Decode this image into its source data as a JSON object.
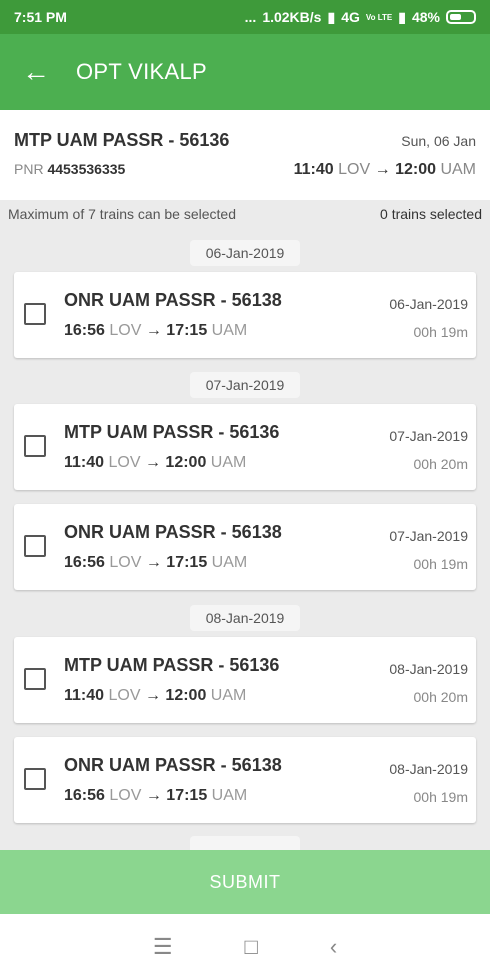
{
  "status_bar": {
    "time": "7:51 PM",
    "dots": "...",
    "speed": "1.02KB/s",
    "net": "4G",
    "volte": "Vo LTE",
    "battery": "48%"
  },
  "app_bar": {
    "title": "OPT VIKALP",
    "back_icon": "arrow-left"
  },
  "summary": {
    "train": "MTP UAM PASSR - 56136",
    "date": "Sun, 06 Jan",
    "pnr_label": "PNR",
    "pnr": "4453536335",
    "dep_time": "11:40",
    "from": "LOV",
    "arr_time": "12:00",
    "to": "UAM"
  },
  "info": {
    "max_text": "Maximum of 7 trains can be selected",
    "selected_text": "0 trains selected"
  },
  "arrow": "→",
  "groups": [
    {
      "date": "06-Jan-2019",
      "trains": [
        {
          "name": "ONR UAM PASSR - 56138",
          "dep": "16:56",
          "from": "LOV",
          "arr": "17:15",
          "to": "UAM",
          "date": "06-Jan-2019",
          "duration": "00h 19m"
        }
      ]
    },
    {
      "date": "07-Jan-2019",
      "trains": [
        {
          "name": "MTP UAM PASSR - 56136",
          "dep": "11:40",
          "from": "LOV",
          "arr": "12:00",
          "to": "UAM",
          "date": "07-Jan-2019",
          "duration": "00h 20m"
        },
        {
          "name": "ONR UAM PASSR - 56138",
          "dep": "16:56",
          "from": "LOV",
          "arr": "17:15",
          "to": "UAM",
          "date": "07-Jan-2019",
          "duration": "00h 19m"
        }
      ]
    },
    {
      "date": "08-Jan-2019",
      "trains": [
        {
          "name": "MTP UAM PASSR - 56136",
          "dep": "11:40",
          "from": "LOV",
          "arr": "12:00",
          "to": "UAM",
          "date": "08-Jan-2019",
          "duration": "00h 20m"
        },
        {
          "name": "ONR UAM PASSR - 56138",
          "dep": "16:56",
          "from": "LOV",
          "arr": "17:15",
          "to": "UAM",
          "date": "08-Jan-2019",
          "duration": "00h 19m"
        }
      ]
    }
  ],
  "submit_label": "SUBMIT",
  "nav": {
    "menu": "☰",
    "home": "□",
    "back": "‹"
  },
  "colors": {
    "primary": "#4caf50",
    "status": "#3e9a3a",
    "submit": "#8bd68f"
  }
}
